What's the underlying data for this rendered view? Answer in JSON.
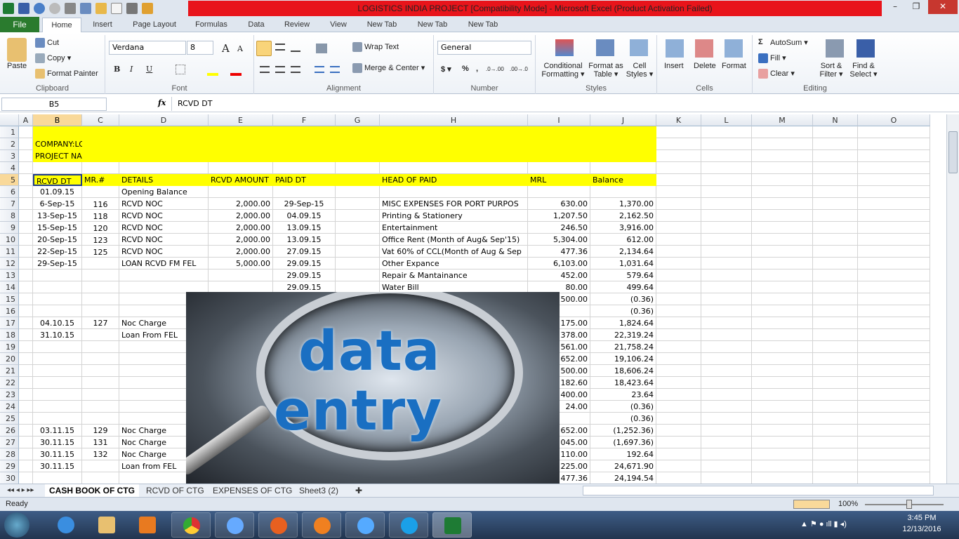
{
  "window": {
    "title": "LOGISTICS INDIA PROJECT  [Compatibility Mode]  -  Microsoft Excel (Product Activation Failed)",
    "min": "–",
    "max": "❐",
    "close": "✕"
  },
  "tabs": [
    "File",
    "Home",
    "Insert",
    "Page Layout",
    "Formulas",
    "Data",
    "Review",
    "View",
    "New Tab",
    "New Tab",
    "New Tab"
  ],
  "ribbon": {
    "clipboard": {
      "label": "Clipboard",
      "paste": "Paste",
      "cut": "Cut",
      "copy": "Copy ▾",
      "format_painter": "Format Painter"
    },
    "font": {
      "label": "Font",
      "name": "Verdana",
      "size": "8",
      "bold": "B",
      "italic": "I",
      "underline": "U",
      "grow": "A",
      "shrink": "A"
    },
    "alignment": {
      "label": "Alignment",
      "wrap": "Wrap Text",
      "merge": "Merge & Center ▾"
    },
    "number": {
      "label": "Number",
      "format": "General",
      "currency": "$ ▾",
      "percent": "%",
      "comma": ",",
      "inc": ".0→.00",
      "dec": ".00→.0"
    },
    "styles": {
      "label": "Styles",
      "conditional": "Conditional Formatting ▾",
      "table": "Format as Table ▾",
      "cell": "Cell Styles ▾"
    },
    "cells": {
      "label": "Cells",
      "insert": "Insert",
      "delete": "Delete",
      "format": "Format"
    },
    "editing": {
      "label": "Editing",
      "autosum": "AutoSum ▾",
      "fill": "Fill ▾",
      "clear": "Clear ▾",
      "sort": "Sort & Filter ▾",
      "find": "Find & Select ▾"
    }
  },
  "formula_bar": {
    "name_box": "B5",
    "fx": "fx",
    "value": "RCVD DT"
  },
  "columns": [
    "A",
    "B",
    "C",
    "D",
    "E",
    "F",
    "G",
    "H",
    "I",
    "J",
    "K",
    "L",
    "M",
    "N",
    "O"
  ],
  "rows": [
    {
      "n": "1",
      "cells": {}
    },
    {
      "n": "2",
      "cells": {
        "B": "COMPANY:LOGISTICS (INDIA)LTD"
      }
    },
    {
      "n": "3",
      "cells": {
        "B": "PROJECT NAME:CASH BOOK  UPDATE"
      }
    },
    {
      "n": "4",
      "cells": {}
    },
    {
      "n": "5",
      "cells": {
        "B": "RCVD DT",
        "C": "MR.#",
        "D": "DETAILS",
        "E": "RCVD AMOUNT",
        "F": "PAID DT",
        "H": "HEAD OF PAID",
        "I": "MRL",
        "J": "Balance"
      }
    },
    {
      "n": "6",
      "cells": {
        "B": "01.09.15",
        "D": "Opening Balance"
      }
    },
    {
      "n": "7",
      "cells": {
        "B": "6-Sep-15",
        "C": "116",
        "D": "RCVD NOC",
        "E": "2,000.00",
        "F": "29-Sep-15",
        "H": "MISC EXPENSES FOR PORT PURPOS",
        "I": "630.00",
        "J": "1,370.00"
      }
    },
    {
      "n": "8",
      "cells": {
        "B": "13-Sep-15",
        "C": "118",
        "D": "RCVD NOC",
        "E": "2,000.00",
        "F": "04.09.15",
        "H": "Printing & Stationery",
        "I": "1,207.50",
        "J": "2,162.50"
      }
    },
    {
      "n": "9",
      "cells": {
        "B": "15-Sep-15",
        "C": "120",
        "D": "RCVD NOC",
        "E": "2,000.00",
        "F": "13.09.15",
        "H": "Entertainment",
        "I": "246.50",
        "J": "3,916.00"
      }
    },
    {
      "n": "10",
      "cells": {
        "B": "20-Sep-15",
        "C": "123",
        "D": "RCVD NOC",
        "E": "2,000.00",
        "F": "13.09.15",
        "H": "Office Rent (Month of Aug& Sep'15)",
        "I": "5,304.00",
        "J": "612.00"
      }
    },
    {
      "n": "11",
      "cells": {
        "B": "22-Sep-15",
        "C": "125",
        "D": "RCVD NOC",
        "E": "2,000.00",
        "F": "27.09.15",
        "H": "Vat 60% of CCL(Month of Aug & Sep",
        "I": "477.36",
        "J": "2,134.64"
      }
    },
    {
      "n": "12",
      "cells": {
        "B": "29-Sep-15",
        "D": "LOAN RCVD FM FEL",
        "E": "5,000.00",
        "F": "29.09.15",
        "H": "Other Expance",
        "I": "6,103.00",
        "J": "1,031.64"
      }
    },
    {
      "n": "13",
      "cells": {
        "F": "29.09.15",
        "H": "Repair & Mantainance",
        "I": "452.00",
        "J": "579.64"
      }
    },
    {
      "n": "14",
      "cells": {
        "F": "29.09.15",
        "H": "Water Bill",
        "I": "80.00",
        "J": "499.64"
      }
    },
    {
      "n": "15",
      "cells": {
        "I": "500.00",
        "J": "(0.36)"
      }
    },
    {
      "n": "16",
      "cells": {
        "J": "(0.36)"
      }
    },
    {
      "n": "17",
      "cells": {
        "B": "04.10.15",
        "C": "127",
        "D": "Noc Charge",
        "I": "175.00",
        "J": "1,824.64"
      }
    },
    {
      "n": "18",
      "cells": {
        "B": "31.10.15",
        "D": "Loan From FEL",
        "I": "378.00",
        "J": "22,319.24"
      }
    },
    {
      "n": "19",
      "cells": {
        "I": "561.00",
        "J": "21,758.24"
      }
    },
    {
      "n": "20",
      "cells": {
        "I": "652.00",
        "J": "19,106.24"
      }
    },
    {
      "n": "21",
      "cells": {
        "I": "500.00",
        "J": "18,606.24"
      }
    },
    {
      "n": "22",
      "cells": {
        "I": "182.60",
        "J": "18,423.64"
      }
    },
    {
      "n": "23",
      "cells": {
        "I": "400.00",
        "J": "23.64"
      }
    },
    {
      "n": "24",
      "cells": {
        "I": "24.00",
        "J": "(0.36)"
      }
    },
    {
      "n": "25",
      "cells": {
        "J": "(0.36)"
      }
    },
    {
      "n": "26",
      "cells": {
        "B": "03.11.15",
        "C": "129",
        "D": "Noc Charge",
        "I": "652.00",
        "J": "(1,252.36)"
      }
    },
    {
      "n": "27",
      "cells": {
        "B": "30.11.15",
        "C": "131",
        "D": "Noc Charge",
        "I": "045.00",
        "J": "(1,697.36)"
      }
    },
    {
      "n": "28",
      "cells": {
        "B": "30.11.15",
        "C": "132",
        "D": "Noc Charge",
        "I": "110.00",
        "J": "192.64"
      }
    },
    {
      "n": "29",
      "cells": {
        "B": "30.11.15",
        "D": "Loan from FEL",
        "I": "225.00",
        "J": "24,671.90"
      }
    },
    {
      "n": "30",
      "cells": {
        "I": "477.36",
        "J": "24,194.54"
      }
    }
  ],
  "overlay_image": {
    "line1": "data",
    "line2": "entry"
  },
  "sheet_tabs": [
    "CASH BOOK OF CTG",
    "RCVD OF CTG",
    "EXPENSES OF CTG",
    "Sheet3 (2)"
  ],
  "status": {
    "ready": "Ready",
    "zoom": "100%"
  },
  "taskbar": {
    "time": "3:45 PM",
    "date": "12/13/2016"
  }
}
